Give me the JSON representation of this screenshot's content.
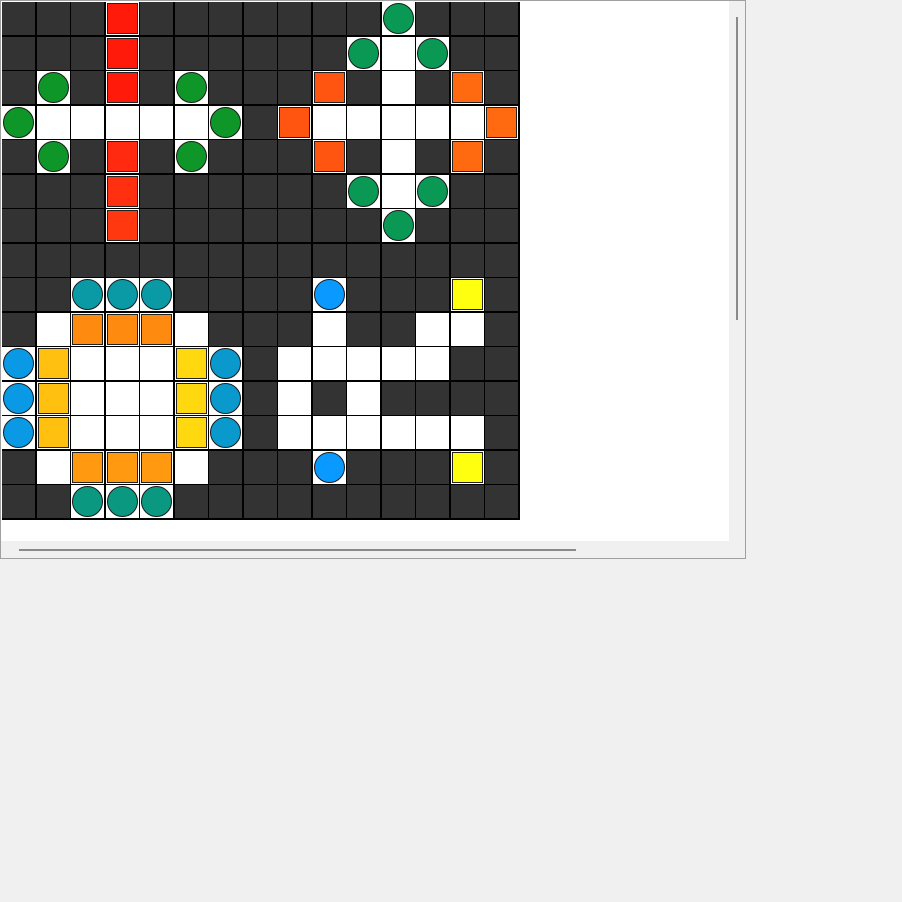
{
  "board": {
    "rows": 15,
    "cols": 15,
    "colors": {
      "dark": "#333333",
      "light": "#ffffff"
    },
    "light_cells": [
      [
        0,
        3
      ],
      [
        0,
        11
      ],
      [
        1,
        3
      ],
      [
        1,
        10
      ],
      [
        1,
        11
      ],
      [
        1,
        12
      ],
      [
        2,
        1
      ],
      [
        2,
        3
      ],
      [
        2,
        5
      ],
      [
        2,
        9
      ],
      [
        2,
        11
      ],
      [
        2,
        13
      ],
      [
        3,
        0
      ],
      [
        3,
        1
      ],
      [
        3,
        2
      ],
      [
        3,
        3
      ],
      [
        3,
        4
      ],
      [
        3,
        5
      ],
      [
        3,
        6
      ],
      [
        3,
        8
      ],
      [
        3,
        9
      ],
      [
        3,
        10
      ],
      [
        3,
        11
      ],
      [
        3,
        12
      ],
      [
        3,
        13
      ],
      [
        3,
        14
      ],
      [
        4,
        1
      ],
      [
        4,
        3
      ],
      [
        4,
        5
      ],
      [
        4,
        9
      ],
      [
        4,
        11
      ],
      [
        4,
        13
      ],
      [
        5,
        3
      ],
      [
        5,
        10
      ],
      [
        5,
        11
      ],
      [
        5,
        12
      ],
      [
        6,
        3
      ],
      [
        6,
        11
      ],
      [
        8,
        2
      ],
      [
        8,
        3
      ],
      [
        8,
        4
      ],
      [
        8,
        9
      ],
      [
        8,
        13
      ],
      [
        9,
        1
      ],
      [
        9,
        2
      ],
      [
        9,
        3
      ],
      [
        9,
        4
      ],
      [
        9,
        5
      ],
      [
        9,
        9
      ],
      [
        9,
        12
      ],
      [
        9,
        13
      ],
      [
        10,
        0
      ],
      [
        10,
        1
      ],
      [
        10,
        2
      ],
      [
        10,
        3
      ],
      [
        10,
        4
      ],
      [
        10,
        5
      ],
      [
        10,
        6
      ],
      [
        10,
        8
      ],
      [
        10,
        9
      ],
      [
        10,
        10
      ],
      [
        10,
        11
      ],
      [
        10,
        12
      ],
      [
        11,
        0
      ],
      [
        11,
        1
      ],
      [
        11,
        2
      ],
      [
        11,
        3
      ],
      [
        11,
        4
      ],
      [
        11,
        5
      ],
      [
        11,
        6
      ],
      [
        11,
        8
      ],
      [
        11,
        10
      ],
      [
        12,
        0
      ],
      [
        12,
        1
      ],
      [
        12,
        2
      ],
      [
        12,
        3
      ],
      [
        12,
        4
      ],
      [
        12,
        5
      ],
      [
        12,
        6
      ],
      [
        12,
        8
      ],
      [
        12,
        9
      ],
      [
        12,
        10
      ],
      [
        12,
        11
      ],
      [
        12,
        12
      ],
      [
        12,
        13
      ],
      [
        13,
        1
      ],
      [
        13,
        2
      ],
      [
        13,
        3
      ],
      [
        13,
        4
      ],
      [
        13,
        5
      ],
      [
        13,
        9
      ],
      [
        13,
        13
      ],
      [
        14,
        2
      ],
      [
        14,
        3
      ],
      [
        14,
        4
      ]
    ],
    "pieces": [
      {
        "row": 0,
        "col": 3,
        "shape": "square",
        "color": "#ff1a0a"
      },
      {
        "row": 1,
        "col": 3,
        "shape": "square",
        "color": "#ff1a0a"
      },
      {
        "row": 2,
        "col": 3,
        "shape": "square",
        "color": "#ff1a0a"
      },
      {
        "row": 4,
        "col": 3,
        "shape": "square",
        "color": "#ff2a10"
      },
      {
        "row": 5,
        "col": 3,
        "shape": "square",
        "color": "#ff3010"
      },
      {
        "row": 6,
        "col": 3,
        "shape": "square",
        "color": "#ff3810"
      },
      {
        "row": 2,
        "col": 1,
        "shape": "circle",
        "color": "#0f9628"
      },
      {
        "row": 2,
        "col": 5,
        "shape": "circle",
        "color": "#0f9628"
      },
      {
        "row": 3,
        "col": 0,
        "shape": "circle",
        "color": "#0f9628"
      },
      {
        "row": 3,
        "col": 6,
        "shape": "circle",
        "color": "#0f9628"
      },
      {
        "row": 4,
        "col": 1,
        "shape": "circle",
        "color": "#0f9628"
      },
      {
        "row": 4,
        "col": 5,
        "shape": "circle",
        "color": "#0f9628"
      },
      {
        "row": 0,
        "col": 11,
        "shape": "circle",
        "color": "#0a9955"
      },
      {
        "row": 1,
        "col": 10,
        "shape": "circle",
        "color": "#0a9955"
      },
      {
        "row": 1,
        "col": 12,
        "shape": "circle",
        "color": "#0a9955"
      },
      {
        "row": 5,
        "col": 10,
        "shape": "circle",
        "color": "#0a9955"
      },
      {
        "row": 5,
        "col": 12,
        "shape": "circle",
        "color": "#0a9955"
      },
      {
        "row": 6,
        "col": 11,
        "shape": "circle",
        "color": "#0a9955"
      },
      {
        "row": 2,
        "col": 9,
        "shape": "square",
        "color": "#ff5510"
      },
      {
        "row": 2,
        "col": 13,
        "shape": "square",
        "color": "#ff6a10"
      },
      {
        "row": 3,
        "col": 8,
        "shape": "square",
        "color": "#ff5510"
      },
      {
        "row": 3,
        "col": 14,
        "shape": "square",
        "color": "#ff6a10"
      },
      {
        "row": 4,
        "col": 9,
        "shape": "square",
        "color": "#ff5510"
      },
      {
        "row": 4,
        "col": 13,
        "shape": "square",
        "color": "#ff6a10"
      },
      {
        "row": 8,
        "col": 2,
        "shape": "circle",
        "color": "#0a9aa5"
      },
      {
        "row": 8,
        "col": 3,
        "shape": "circle",
        "color": "#0a9aa5"
      },
      {
        "row": 8,
        "col": 4,
        "shape": "circle",
        "color": "#0a9aa5"
      },
      {
        "row": 14,
        "col": 2,
        "shape": "circle",
        "color": "#0a9980"
      },
      {
        "row": 14,
        "col": 3,
        "shape": "circle",
        "color": "#0a9980"
      },
      {
        "row": 14,
        "col": 4,
        "shape": "circle",
        "color": "#0a9980"
      },
      {
        "row": 9,
        "col": 2,
        "shape": "square",
        "color": "#ff8a10"
      },
      {
        "row": 9,
        "col": 3,
        "shape": "square",
        "color": "#ff8a10"
      },
      {
        "row": 9,
        "col": 4,
        "shape": "square",
        "color": "#ff8a10"
      },
      {
        "row": 13,
        "col": 2,
        "shape": "square",
        "color": "#ff9a10"
      },
      {
        "row": 13,
        "col": 3,
        "shape": "square",
        "color": "#ff9a10"
      },
      {
        "row": 13,
        "col": 4,
        "shape": "square",
        "color": "#ff9a10"
      },
      {
        "row": 10,
        "col": 0,
        "shape": "circle",
        "color": "#0a99e5"
      },
      {
        "row": 11,
        "col": 0,
        "shape": "circle",
        "color": "#0a99e5"
      },
      {
        "row": 12,
        "col": 0,
        "shape": "circle",
        "color": "#0a99e5"
      },
      {
        "row": 10,
        "col": 6,
        "shape": "circle",
        "color": "#0a99cc"
      },
      {
        "row": 11,
        "col": 6,
        "shape": "circle",
        "color": "#0a99cc"
      },
      {
        "row": 12,
        "col": 6,
        "shape": "circle",
        "color": "#0a99cc"
      },
      {
        "row": 10,
        "col": 1,
        "shape": "square",
        "color": "#ffc010"
      },
      {
        "row": 11,
        "col": 1,
        "shape": "square",
        "color": "#ffc010"
      },
      {
        "row": 12,
        "col": 1,
        "shape": "square",
        "color": "#ffc010"
      },
      {
        "row": 10,
        "col": 5,
        "shape": "square",
        "color": "#ffd810"
      },
      {
        "row": 11,
        "col": 5,
        "shape": "square",
        "color": "#ffd810"
      },
      {
        "row": 12,
        "col": 5,
        "shape": "square",
        "color": "#ffd810"
      },
      {
        "row": 8,
        "col": 9,
        "shape": "circle",
        "color": "#0a99ff"
      },
      {
        "row": 13,
        "col": 9,
        "shape": "circle",
        "color": "#0a99ff"
      },
      {
        "row": 8,
        "col": 13,
        "shape": "square",
        "color": "#ffff10"
      },
      {
        "row": 13,
        "col": 13,
        "shape": "square",
        "color": "#ffff10"
      }
    ]
  },
  "scrollbars": {
    "vertical": {
      "visible_fraction": 0.56
    },
    "horizontal": {
      "visible_fraction": 0.77
    }
  }
}
